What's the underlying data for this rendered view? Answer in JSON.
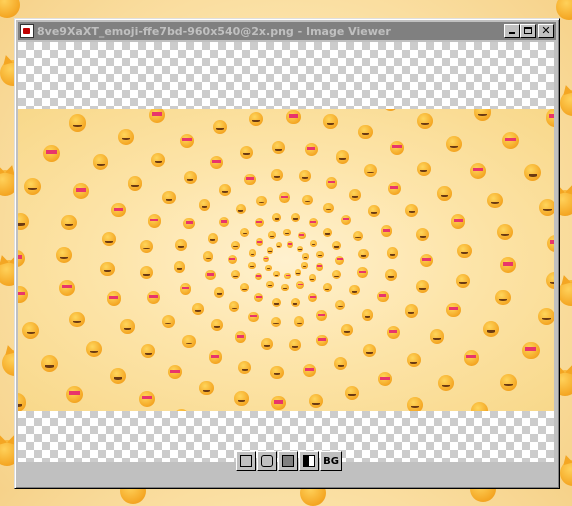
{
  "window": {
    "title": "8ve9XaXT_emoji-ffe7bd-960x540@2x.png - Image Viewer",
    "title_active": false
  },
  "titlebar_buttons": [
    {
      "name": "minimize",
      "icon": "minimize-icon"
    },
    {
      "name": "maximize",
      "icon": "maximize-icon"
    },
    {
      "name": "close",
      "icon": "close-icon",
      "glyph": "✕"
    }
  ],
  "image": {
    "description_color": "#ffe7bd",
    "content": "radial tunnel pattern of cat emoji faces"
  },
  "toolbar": {
    "buttons": [
      {
        "name": "fit-to-window",
        "icon": "fit-window-icon",
        "label": ""
      },
      {
        "name": "actual-size",
        "icon": "actual-size-icon",
        "label": ""
      },
      {
        "name": "dark-background",
        "icon": "dark-bg-icon",
        "label": ""
      },
      {
        "name": "checkerboard-background",
        "icon": "checker-bg-icon",
        "label": ""
      },
      {
        "name": "background-color",
        "icon": "",
        "label": "BG"
      }
    ]
  },
  "colors": {
    "titlebar_inactive": "#808080",
    "window_face": "#c0c0c0",
    "emoji_orange": "#f4a623",
    "heart_pink": "#e8356b"
  }
}
